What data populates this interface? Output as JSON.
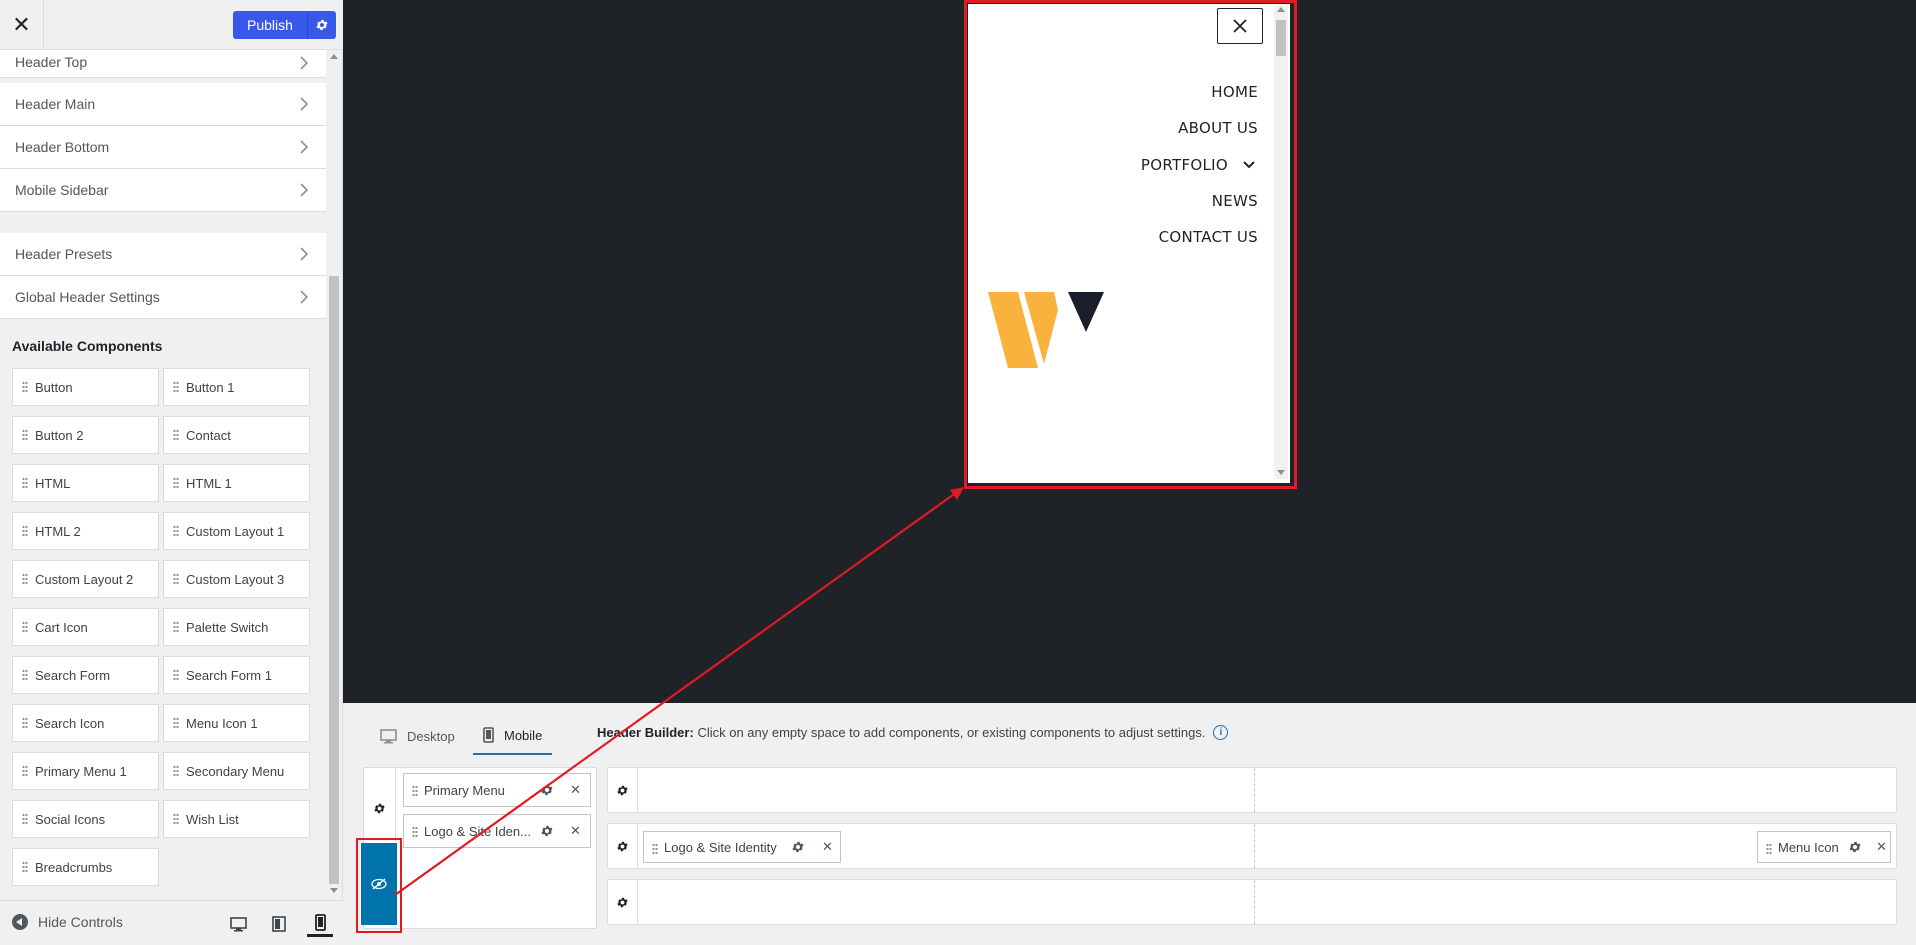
{
  "sidebar": {
    "publish_label": "Publish",
    "sections": [
      {
        "label": "Header Top"
      },
      {
        "label": "Header Main"
      },
      {
        "label": "Header Bottom"
      },
      {
        "label": "Mobile Sidebar"
      },
      {
        "label": "Header Presets"
      },
      {
        "label": "Global Header Settings"
      }
    ],
    "available_title": "Available Components",
    "components": [
      "Button",
      "Button 1",
      "Button 2",
      "Contact",
      "HTML",
      "HTML 1",
      "HTML 2",
      "Custom Layout 1",
      "Custom Layout 2",
      "Custom Layout 3",
      "Cart Icon",
      "Palette Switch",
      "Search Form",
      "Search Form 1",
      "Search Icon",
      "Menu Icon 1",
      "Primary Menu 1",
      "Secondary Menu",
      "Social Icons",
      "Wish List",
      "Breadcrumbs"
    ],
    "hide_controls": "Hide Controls"
  },
  "preview": {
    "menu": [
      "HOME",
      "ABOUT US",
      "PORTFOLIO",
      "NEWS",
      "CONTACT US"
    ],
    "logo_colors": {
      "primary": "#F9B23E",
      "secondary": "#1B1F2B"
    }
  },
  "builder": {
    "tabs": [
      {
        "label": "Desktop",
        "icon": "desktop-icon"
      },
      {
        "label": "Mobile",
        "icon": "mobile-icon"
      }
    ],
    "help_bold": "Header Builder:",
    "help_text": "Click on any empty space to add components, or existing components to adjust settings.",
    "offcanvas_items": [
      "Primary Menu",
      "Logo & Site Iden..."
    ],
    "main_row_left": "Logo & Site Identity",
    "main_row_right": "Menu Icon"
  },
  "colors": {
    "accent": "#3858E9",
    "highlight": "#E01B24",
    "active_blue": "#0073AA"
  }
}
